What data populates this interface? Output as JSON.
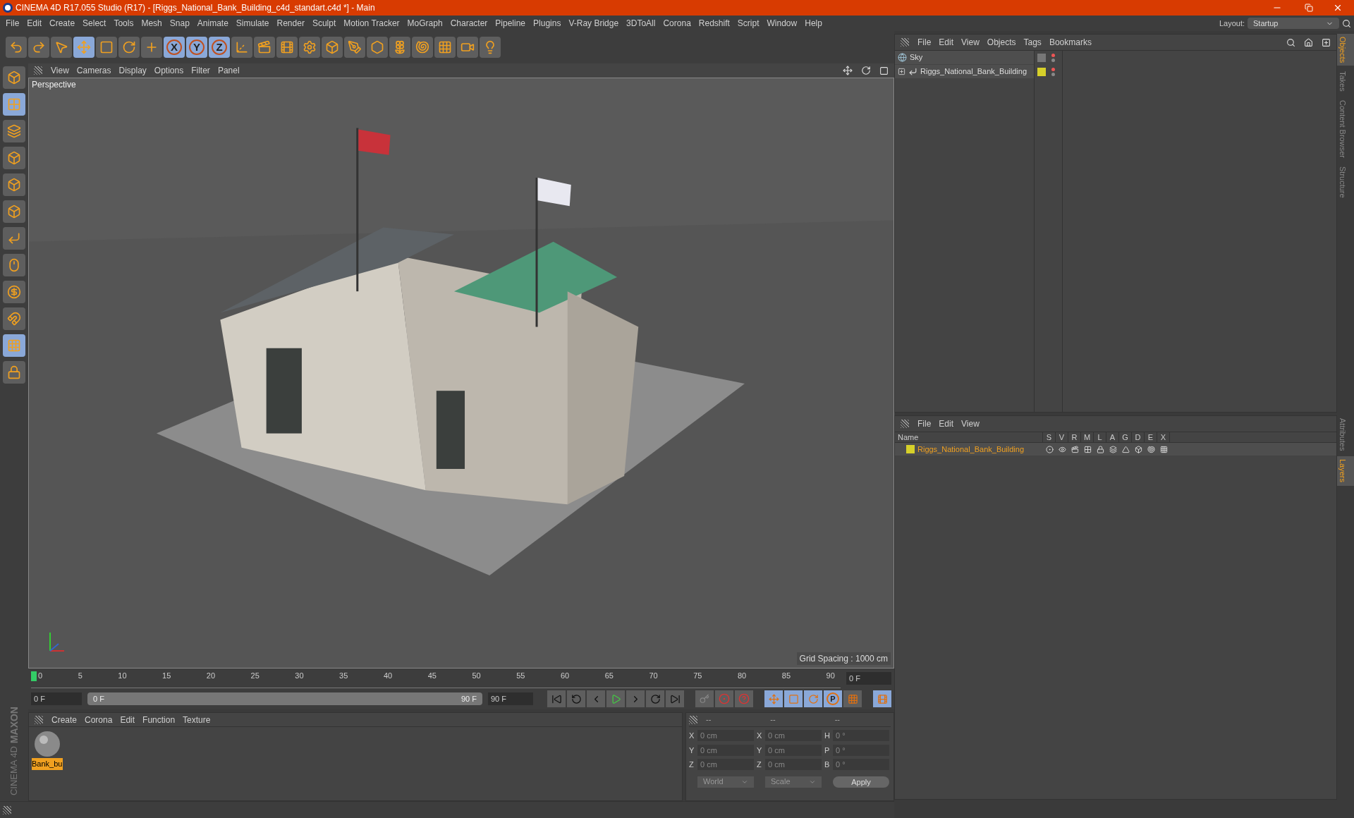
{
  "window": {
    "title": "CINEMA 4D R17.055 Studio (R17) - [Riggs_National_Bank_Building_c4d_standart.c4d *] - Main"
  },
  "menu": [
    "File",
    "Edit",
    "Create",
    "Select",
    "Tools",
    "Mesh",
    "Snap",
    "Animate",
    "Simulate",
    "Render",
    "Sculpt",
    "Motion Tracker",
    "MoGraph",
    "Character",
    "Pipeline",
    "Plugins",
    "V-Ray Bridge",
    "3DToAll",
    "Corona",
    "Redshift",
    "Script",
    "Window",
    "Help"
  ],
  "layout": {
    "label": "Layout:",
    "value": "Startup"
  },
  "toolbar": [
    {
      "kind": "icon",
      "active": false
    },
    {
      "kind": "icon",
      "active": false
    },
    {
      "kind": "icon",
      "active": false
    },
    {
      "kind": "icon",
      "active": true
    },
    {
      "kind": "icon",
      "active": false
    },
    {
      "kind": "icon",
      "active": false
    },
    {
      "kind": "icon",
      "active": false
    },
    {
      "kind": "letter",
      "label": "X",
      "active": true
    },
    {
      "kind": "letter",
      "label": "Y",
      "active": true
    },
    {
      "kind": "letter",
      "label": "Z",
      "active": true
    },
    {
      "kind": "icon",
      "active": false
    },
    {
      "kind": "icon",
      "active": false
    },
    {
      "kind": "icon",
      "active": false
    },
    {
      "kind": "icon",
      "active": false
    },
    {
      "kind": "icon",
      "active": false
    },
    {
      "kind": "icon",
      "active": false
    },
    {
      "kind": "icon",
      "active": false
    },
    {
      "kind": "icon",
      "active": false
    },
    {
      "kind": "icon",
      "active": false
    },
    {
      "kind": "icon",
      "active": false
    },
    {
      "kind": "icon",
      "active": false
    },
    {
      "kind": "icon",
      "active": false
    }
  ],
  "side_tools": [
    {
      "active": false
    },
    {
      "active": true
    },
    {
      "active": false
    },
    {
      "active": false
    },
    {
      "active": false
    },
    {
      "active": false
    },
    {
      "active": false
    },
    {
      "active": false
    },
    {
      "active": false
    },
    {
      "active": false
    },
    {
      "active": true
    },
    {
      "active": false
    }
  ],
  "viewport": {
    "menu": [
      "View",
      "Cameras",
      "Display",
      "Options",
      "Filter",
      "Panel"
    ],
    "label": "Perspective",
    "grid_spacing": "Grid Spacing : 1000 cm"
  },
  "timeline": {
    "ruler": [
      "0",
      "5",
      "10",
      "15",
      "20",
      "25",
      "30",
      "35",
      "40",
      "45",
      "50",
      "55",
      "60",
      "65",
      "70",
      "75",
      "80",
      "85",
      "90"
    ],
    "playhead": {
      "level": 0
    },
    "current_frame": "0 F",
    "start_field": "0 F",
    "range": {
      "level": 1
    },
    "range_start": "0 F",
    "range_end": "90 F",
    "end_field": "90 F",
    "p_label": "P"
  },
  "materials": {
    "menu": [
      "Create",
      "Corona",
      "Edit",
      "Function",
      "Texture"
    ],
    "items": [
      {
        "name": "Bank_bu",
        "selected": true
      }
    ]
  },
  "coords": {
    "headers": [
      "--",
      "--",
      "--"
    ],
    "rows": [
      {
        "cells": [
          {
            "axis": "X",
            "value": "0 cm"
          },
          {
            "axis": "X",
            "value": "0 cm"
          },
          {
            "axis": "H",
            "value": "0 °"
          }
        ]
      },
      {
        "cells": [
          {
            "axis": "Y",
            "value": "0 cm"
          },
          {
            "axis": "Y",
            "value": "0 cm"
          },
          {
            "axis": "P",
            "value": "0 °"
          }
        ]
      },
      {
        "cells": [
          {
            "axis": "Z",
            "value": "0 cm"
          },
          {
            "axis": "Z",
            "value": "0 cm"
          },
          {
            "axis": "B",
            "value": "0 °"
          }
        ]
      }
    ],
    "mode": "World",
    "transform": "Scale",
    "apply": "Apply"
  },
  "objects": {
    "menu": [
      "File",
      "Edit",
      "View",
      "Objects",
      "Tags",
      "Bookmarks"
    ],
    "items": [
      {
        "name": "Sky",
        "kind": "sky"
      },
      {
        "name": "Riggs_National_Bank_Building",
        "kind": "null",
        "color": "#d6d02a"
      }
    ]
  },
  "layers": {
    "menu": [
      "File",
      "Edit",
      "View"
    ],
    "columns": [
      "Name",
      "S",
      "V",
      "R",
      "M",
      "L",
      "A",
      "G",
      "D",
      "E",
      "X"
    ],
    "items": [
      {
        "name": "Riggs_National_Bank_Building",
        "color": "#d6d02a"
      }
    ]
  },
  "side_tabs_top": [
    {
      "label": "Objects",
      "selected": true
    },
    {
      "label": "Takes",
      "selected": false
    },
    {
      "label": "Content Browser",
      "selected": false
    },
    {
      "label": "Structure",
      "selected": false
    }
  ],
  "side_tabs_bottom": [
    {
      "label": "Attributes",
      "selected": false
    },
    {
      "label": "Layers",
      "selected": true
    }
  ],
  "brand": {
    "line1": "MAXON",
    "line2": "CINEMA 4D"
  }
}
